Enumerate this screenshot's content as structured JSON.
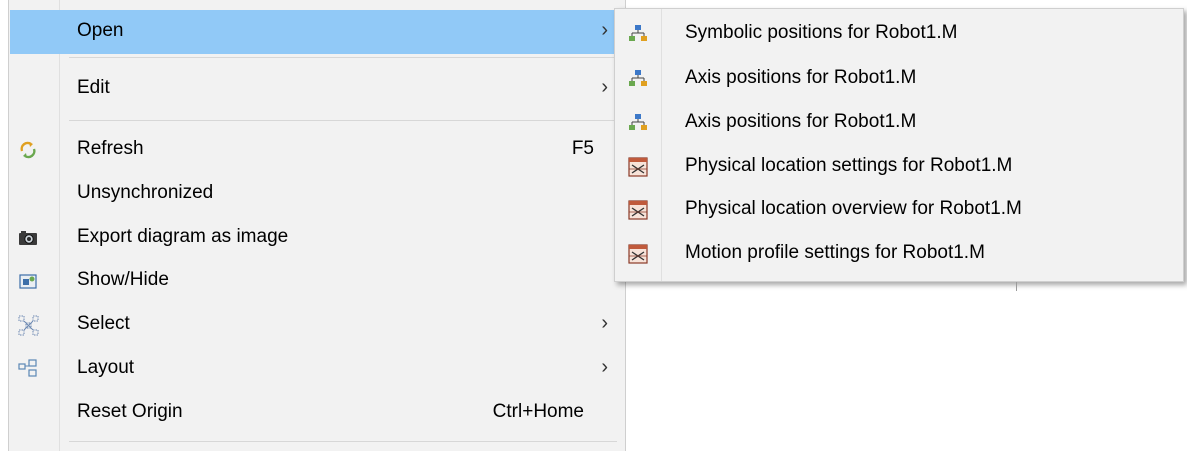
{
  "main_menu": {
    "items": [
      {
        "label": "Open",
        "arrow": "›",
        "icon": ""
      },
      {
        "label": "Edit",
        "arrow": "›",
        "icon": ""
      },
      {
        "label": "Refresh",
        "shortcut": "F5",
        "icon": "refresh-icon"
      },
      {
        "label": "Unsynchronized",
        "icon": ""
      },
      {
        "label": "Export diagram as image",
        "icon": "camera-icon"
      },
      {
        "label": "Show/Hide",
        "icon": "show-hide-icon"
      },
      {
        "label": "Select",
        "arrow": "›",
        "icon": "select-icon"
      },
      {
        "label": "Layout",
        "arrow": "›",
        "icon": "layout-icon"
      },
      {
        "label": "Reset Origin",
        "shortcut": "Ctrl+Home",
        "icon": ""
      }
    ]
  },
  "sub_menu": {
    "items": [
      {
        "label": "Symbolic positions for Robot1.M",
        "icon": "hierarchy-icon"
      },
      {
        "label": "Axis positions for Robot1.M",
        "icon": "hierarchy-icon"
      },
      {
        "label": "Axis positions for Robot1.M",
        "icon": "hierarchy-icon"
      },
      {
        "label": "Physical location settings for Robot1.M",
        "icon": "settings-table-icon"
      },
      {
        "label": "Physical location overview for Robot1.M",
        "icon": "settings-table-icon"
      },
      {
        "label": "Motion profile settings for Robot1.M",
        "icon": "settings-table-icon"
      }
    ]
  },
  "colors": {
    "highlight": "#91c9f7",
    "menu_bg": "#f2f2f2",
    "separator": "#d7d7d7"
  }
}
